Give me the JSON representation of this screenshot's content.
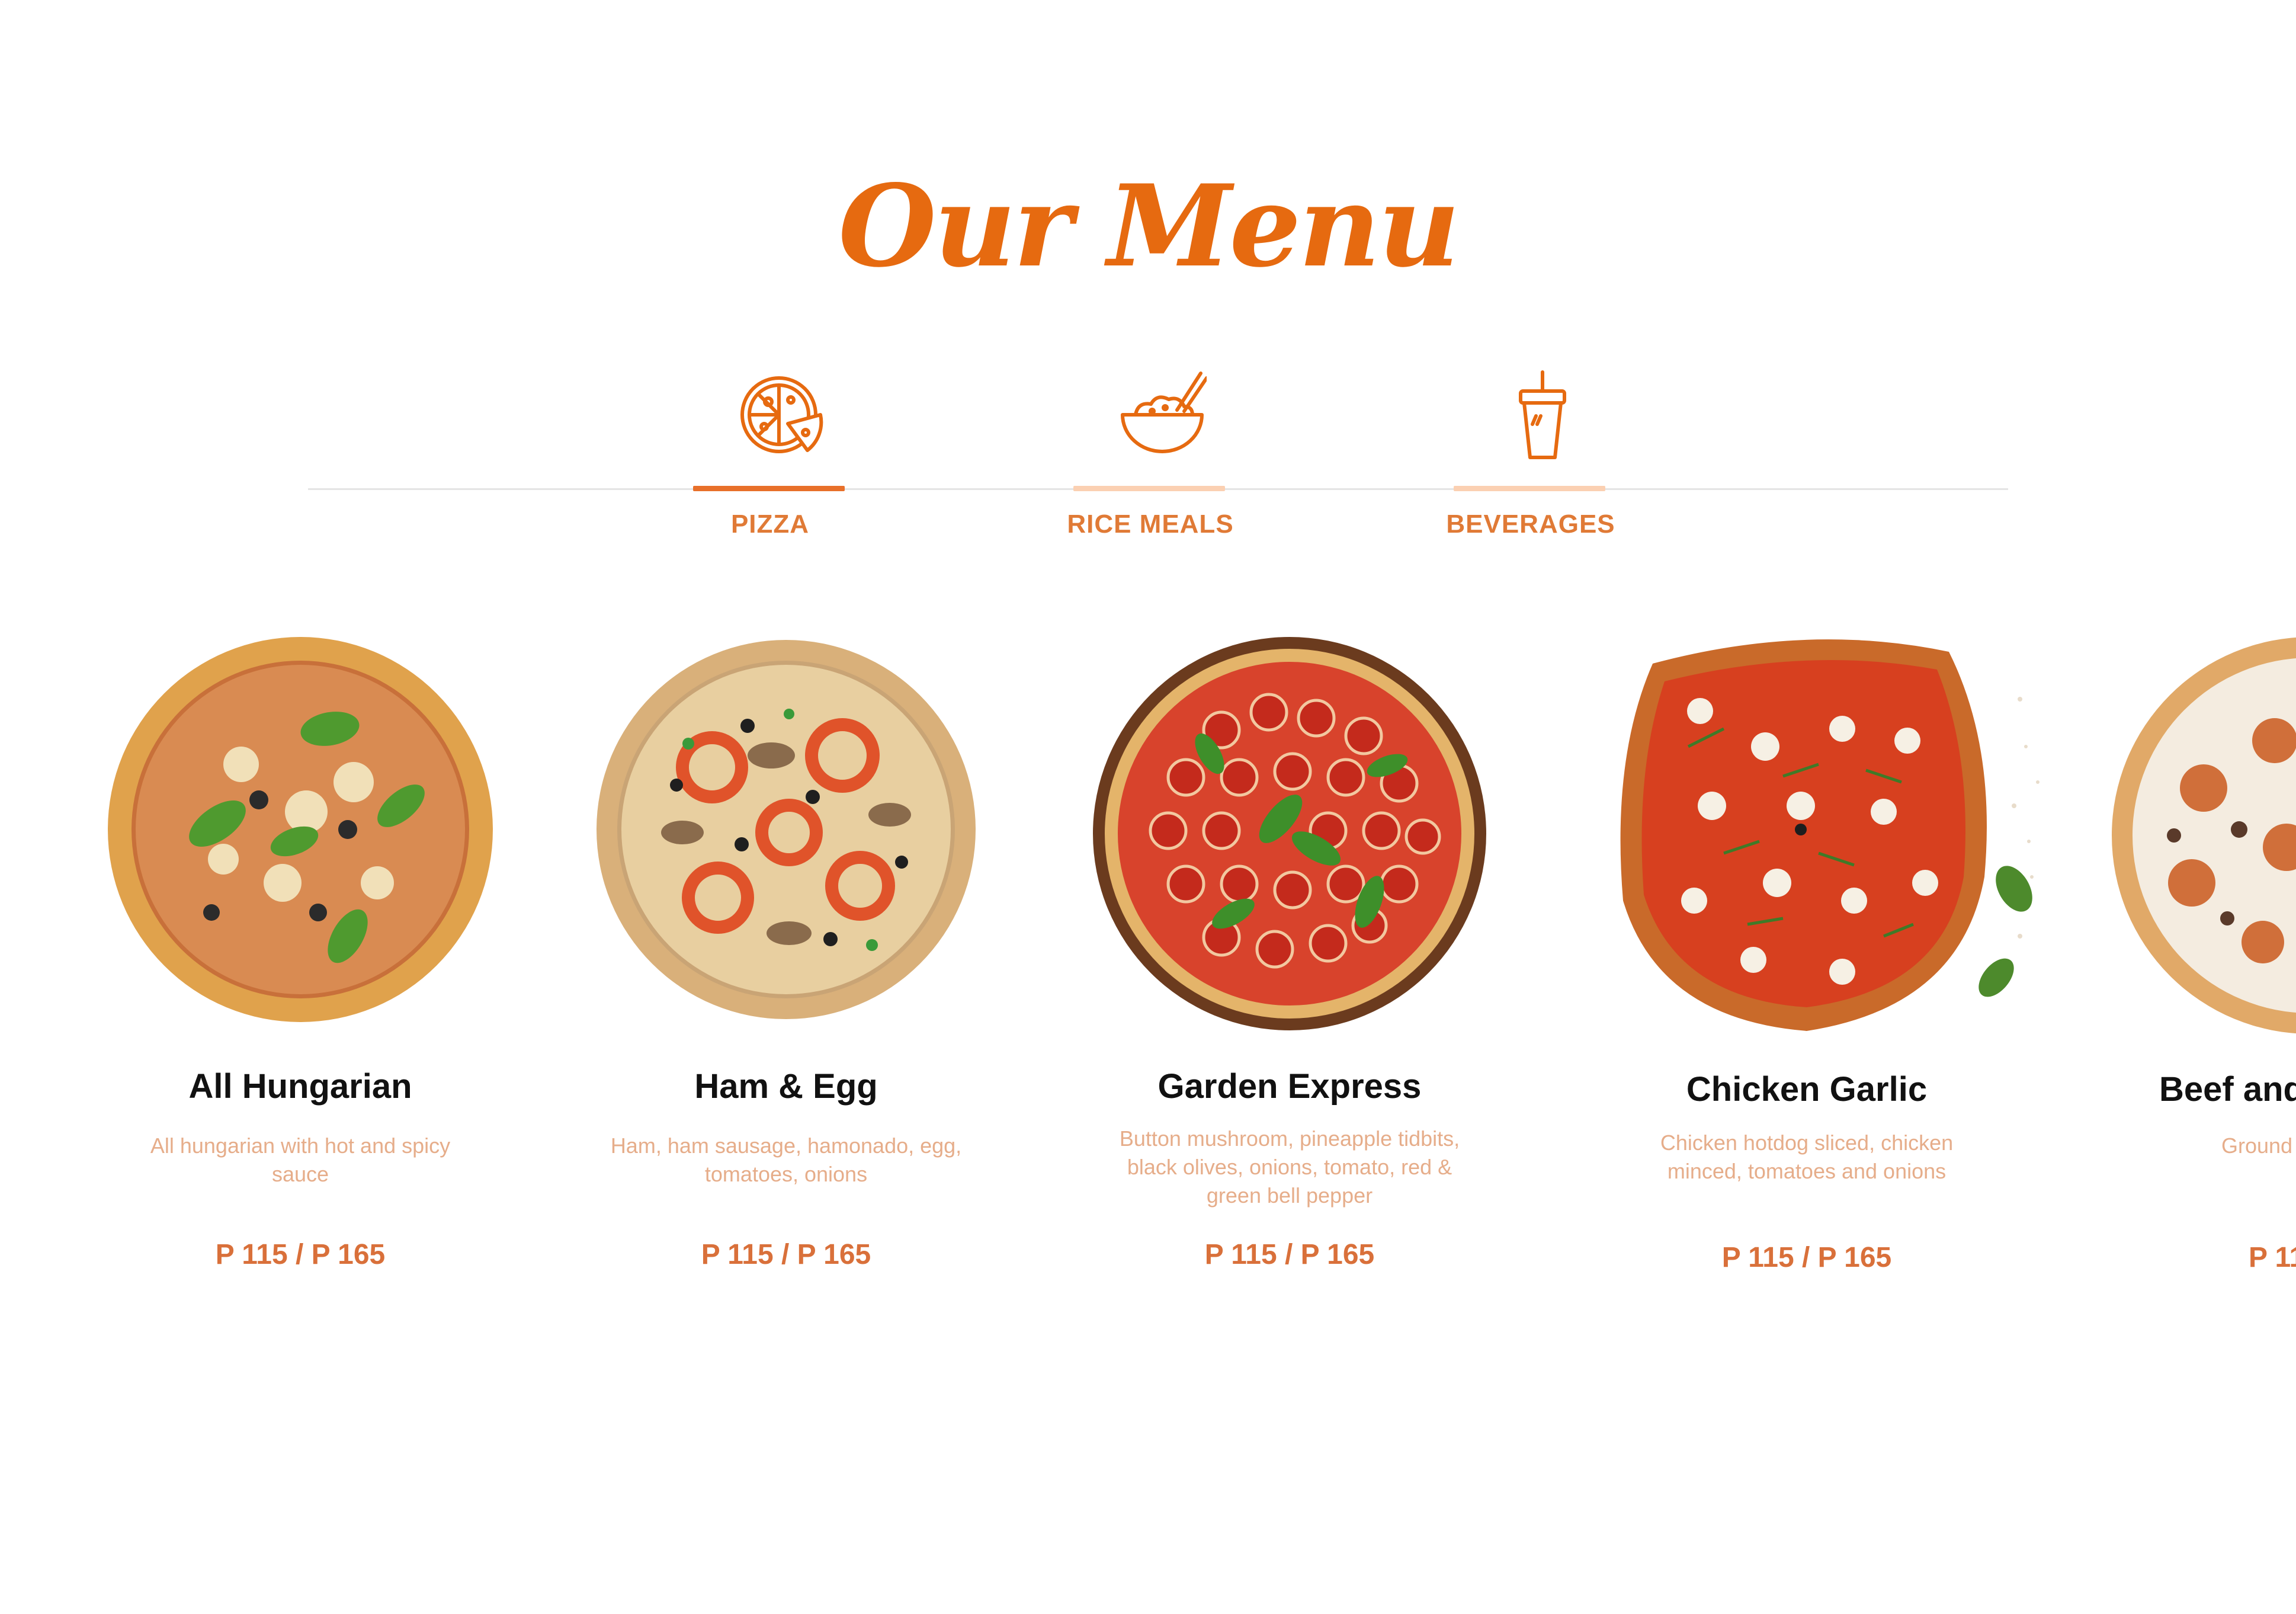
{
  "header": {
    "title": "Our Menu"
  },
  "tabs": [
    {
      "label": "PIZZA",
      "icon": "pizza-icon",
      "active": true
    },
    {
      "label": "RICE MEALS",
      "icon": "rice-bowl-icon",
      "active": false
    },
    {
      "label": "BEVERAGES",
      "icon": "drink-cup-icon",
      "active": false
    }
  ],
  "colors": {
    "accent": "#e66a10",
    "active_bar": "#e8702a",
    "inactive_bar": "#fbd0b2",
    "desc": "#e6ad8a",
    "price": "#d9703a"
  },
  "items": [
    {
      "name": "All Hungarian",
      "description": "All hungarian with hot and spicy sauce",
      "price": "P 115 / P 165"
    },
    {
      "name": "Ham & Egg",
      "description": "Ham, ham sausage, hamonado, egg, tomatoes, onions",
      "price": "P 115 / P 165"
    },
    {
      "name": "Garden Express",
      "description": "Button mushroom, pineapple tidbits, black olives, onions, tomato, red & green bell pepper",
      "price": "P 115 / P 165"
    },
    {
      "name": "Chicken Garlic",
      "description": "Chicken hotdog sliced, chicken minced, tomatoes and onions",
      "price": "P 115 / P 165"
    },
    {
      "name": "Beef and",
      "description": "Ground red",
      "price": "P 11"
    }
  ]
}
